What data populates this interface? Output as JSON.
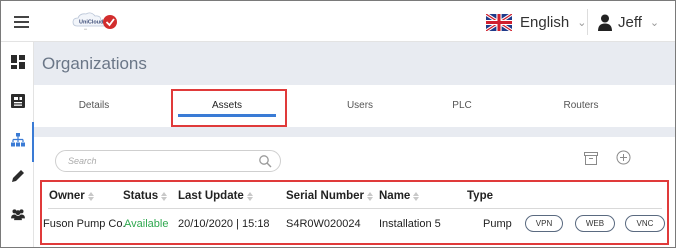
{
  "header": {
    "logo_text": "UniCloud",
    "language": "English",
    "user_name": "Jeff"
  },
  "sidebar": {
    "items": [
      {
        "icon": "dashboard-icon"
      },
      {
        "icon": "device-icon"
      },
      {
        "icon": "org-tree-icon",
        "active": true
      },
      {
        "icon": "pencil-icon"
      },
      {
        "icon": "users-icon"
      }
    ]
  },
  "page": {
    "title": "Organizations"
  },
  "tabs": [
    {
      "label": "Details"
    },
    {
      "label": "Assets",
      "active": true
    },
    {
      "label": "Users"
    },
    {
      "label": "PLC"
    },
    {
      "label": "Routers"
    }
  ],
  "search": {
    "placeholder": "Search"
  },
  "table": {
    "columns": [
      "Owner",
      "Status",
      "Last Update",
      "Serial Number",
      "Name",
      "Type"
    ],
    "rows": [
      {
        "owner": "Fuson Pump Co.",
        "status": "Available",
        "last_update": "20/10/2020 | 15:18",
        "serial_number": "S4R0W020024",
        "name": "Installation 5",
        "type": "Pump",
        "actions": [
          "VPN",
          "WEB",
          "VNC"
        ]
      }
    ]
  },
  "colors": {
    "accent": "#3a7bd5",
    "highlight": "#e03a3a",
    "status_available": "#2fa84f",
    "background": "#e8ebf1"
  }
}
